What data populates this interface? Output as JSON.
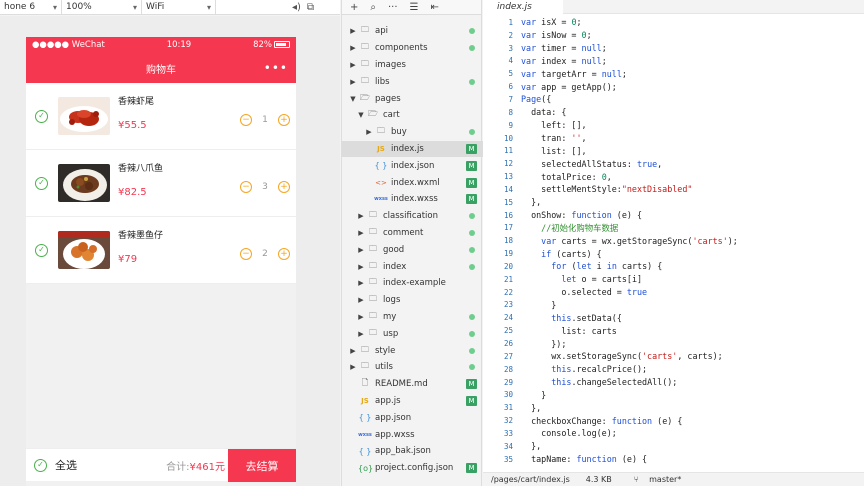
{
  "toolbar": {
    "device": "hone 6",
    "zoom": "100%",
    "network": "WiFi"
  },
  "phone": {
    "carrier": "●●●●● WeChat",
    "time": "10:19",
    "battery": "82%",
    "nav_title": "购物车",
    "more": "•••"
  },
  "cart": {
    "items": [
      {
        "name": "香辣虾尾",
        "price": "¥55.5",
        "qty": "1"
      },
      {
        "name": "香辣八爪鱼",
        "price": "¥82.5",
        "qty": "3"
      },
      {
        "name": "香辣墨鱼仔",
        "price": "¥79",
        "qty": "2"
      }
    ],
    "select_all": "全选",
    "total_label": "合计:",
    "total_amount": "¥461元",
    "checkout": "去结算"
  },
  "explorer": {
    "tree": [
      {
        "name": "api",
        "type": "folder",
        "depth": 0,
        "open": false,
        "badge": "dot"
      },
      {
        "name": "components",
        "type": "folder",
        "depth": 0,
        "open": false,
        "badge": "dot"
      },
      {
        "name": "images",
        "type": "folder",
        "depth": 0,
        "open": false,
        "badge": ""
      },
      {
        "name": "libs",
        "type": "folder",
        "depth": 0,
        "open": false,
        "badge": "dot"
      },
      {
        "name": "pages",
        "type": "folder",
        "depth": 0,
        "open": true,
        "badge": ""
      },
      {
        "name": "cart",
        "type": "folder",
        "depth": 1,
        "open": true,
        "badge": ""
      },
      {
        "name": "buy",
        "type": "folder",
        "depth": 2,
        "open": false,
        "badge": "dot"
      },
      {
        "name": "index.js",
        "type": "js",
        "depth": 2,
        "open": false,
        "badge": "M",
        "selected": true
      },
      {
        "name": "index.json",
        "type": "json",
        "depth": 2,
        "open": false,
        "badge": "M"
      },
      {
        "name": "index.wxml",
        "type": "wxml",
        "depth": 2,
        "open": false,
        "badge": "M"
      },
      {
        "name": "index.wxss",
        "type": "wxss",
        "depth": 2,
        "open": false,
        "badge": "M"
      },
      {
        "name": "classification",
        "type": "folder",
        "depth": 1,
        "open": false,
        "badge": "dot"
      },
      {
        "name": "comment",
        "type": "folder",
        "depth": 1,
        "open": false,
        "badge": "dot"
      },
      {
        "name": "good",
        "type": "folder",
        "depth": 1,
        "open": false,
        "badge": "dot"
      },
      {
        "name": "index",
        "type": "folder",
        "depth": 1,
        "open": false,
        "badge": "dot"
      },
      {
        "name": "index-example",
        "type": "folder",
        "depth": 1,
        "open": false,
        "badge": ""
      },
      {
        "name": "logs",
        "type": "folder",
        "depth": 1,
        "open": false,
        "badge": ""
      },
      {
        "name": "my",
        "type": "folder",
        "depth": 1,
        "open": false,
        "badge": "dot"
      },
      {
        "name": "usp",
        "type": "folder",
        "depth": 1,
        "open": false,
        "badge": "dot"
      },
      {
        "name": "style",
        "type": "folder",
        "depth": 0,
        "open": false,
        "badge": "dot"
      },
      {
        "name": "utils",
        "type": "folder",
        "depth": 0,
        "open": false,
        "badge": "dot"
      },
      {
        "name": "README.md",
        "type": "md",
        "depth": 0,
        "open": false,
        "badge": "M"
      },
      {
        "name": "app.js",
        "type": "js",
        "depth": 0,
        "open": false,
        "badge": "M"
      },
      {
        "name": "app.json",
        "type": "json",
        "depth": 0,
        "open": false,
        "badge": ""
      },
      {
        "name": "app.wxss",
        "type": "wxss",
        "depth": 0,
        "open": false,
        "badge": ""
      },
      {
        "name": "app_bak.json",
        "type": "json",
        "depth": 0,
        "open": false,
        "badge": ""
      },
      {
        "name": "project.config.json",
        "type": "config",
        "depth": 0,
        "open": false,
        "badge": "M"
      }
    ]
  },
  "editor": {
    "tab": "index.js",
    "lines": [
      "var isX = 0;",
      "var isNow = 0;",
      "var timer = null;",
      "var index = null;",
      "var targetArr = null;",
      "var app = getApp();",
      "Page({",
      "  data: {",
      "    left: [],",
      "    tran: '',",
      "    list: [],",
      "    selectedAllStatus: true,",
      "    totalPrice: 0,",
      "    settleMentStyle:\"nextDisabled\"",
      "  },",
      "  onShow: function (e) {",
      "    //初始化购物车数据",
      "    var carts = wx.getStorageSync('carts');",
      "    if (carts) {",
      "      for (let i in carts) {",
      "        let o = carts[i]",
      "        o.selected = true",
      "      }",
      "      this.setData({",
      "        list: carts",
      "      });",
      "      wx.setStorageSync('carts', carts);",
      "      this.recalcPrice();",
      "      this.changeSelectedAll();",
      "    }",
      "  },",
      "  checkboxChange: function (e) {",
      "    console.log(e);",
      "  },",
      "  tapName: function (e) {"
    ]
  },
  "status": {
    "path": "/pages/cart/index.js",
    "size": "4.3 KB",
    "branch": "master*"
  }
}
